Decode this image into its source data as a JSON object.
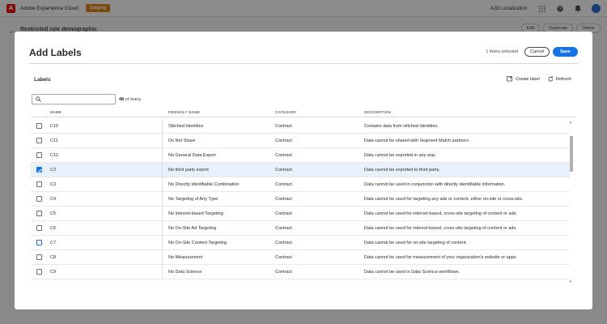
{
  "shell": {
    "app_name": "Adobe Experience Cloud",
    "env_badge": "Staging",
    "org_name": "AJO Localization",
    "logo_letter": "A",
    "icons": [
      "apps-grid-icon",
      "help-icon",
      "bell-icon",
      "avatar"
    ]
  },
  "background_page": {
    "title": "Restricted role demographic",
    "actions": [
      "Edit",
      "Duplicate",
      "Delete"
    ]
  },
  "dialog": {
    "title": "Add Labels",
    "selected_count": "1 items selected",
    "cancel_label": "Cancel",
    "save_label": "Save",
    "section_title": "Labels",
    "create_label": "Create label",
    "refresh_label": "Refresh",
    "search_placeholder": "",
    "result_count_bold": "48",
    "result_count_rest": " of many",
    "columns": {
      "name": "NAME",
      "friendly_name": "FRIENDLY NAME",
      "category": "CATEGORY",
      "description": "DESCRIPTION"
    },
    "rows": [
      {
        "name": "C10",
        "friendly_name": "Stitched Identities",
        "category": "Contract",
        "description": "Contains data from stitched identities.",
        "checked": false
      },
      {
        "name": "C11",
        "friendly_name": "Do Not Share",
        "category": "Contract",
        "description": "Data cannot be shared with Segment Match partners.",
        "checked": false
      },
      {
        "name": "C12",
        "friendly_name": "No General Data Export",
        "category": "Contract",
        "description": "Data cannot be exported in any way.",
        "checked": false
      },
      {
        "name": "C2",
        "friendly_name": "No third party export",
        "category": "Contract",
        "description": "Data cannot be exported to third party.",
        "checked": true
      },
      {
        "name": "C3",
        "friendly_name": "No Directly Identifiable Combination",
        "category": "Contract",
        "description": "Data cannot be used in conjunction with directly identifiable information.",
        "checked": false
      },
      {
        "name": "C4",
        "friendly_name": "No Targeting of Any Type",
        "category": "Contract",
        "description": "Data cannot be used for targeting any ads or content, either on-site or cross-site.",
        "checked": false
      },
      {
        "name": "C5",
        "friendly_name": "No Interest-based Targeting",
        "category": "Contract",
        "description": "Data cannot be used for internet-based, cross-site targeting of content or ads.",
        "checked": false
      },
      {
        "name": "C6",
        "friendly_name": "No On-Site Ad Targeting",
        "category": "Contract",
        "description": "Data cannot be used for interest-based, cross-site targeting of content or ads.",
        "checked": false
      },
      {
        "name": "C7",
        "friendly_name": "No On-Site Content Targeting",
        "category": "Contract",
        "description": "Data cannot be used for on-site targeting of content.",
        "checked": false
      },
      {
        "name": "C8",
        "friendly_name": "No Measurement",
        "category": "Contract",
        "description": "Data cannot be used for measurement of your organization's website or apps.",
        "checked": false
      },
      {
        "name": "C9",
        "friendly_name": "No Data Science",
        "category": "Contract",
        "description": "Data cannot be used in Data Science workflows.",
        "checked": false
      }
    ]
  },
  "colors": {
    "accent": "#1473e6",
    "staging": "#e68619",
    "adobe_red": "#eb1000"
  }
}
